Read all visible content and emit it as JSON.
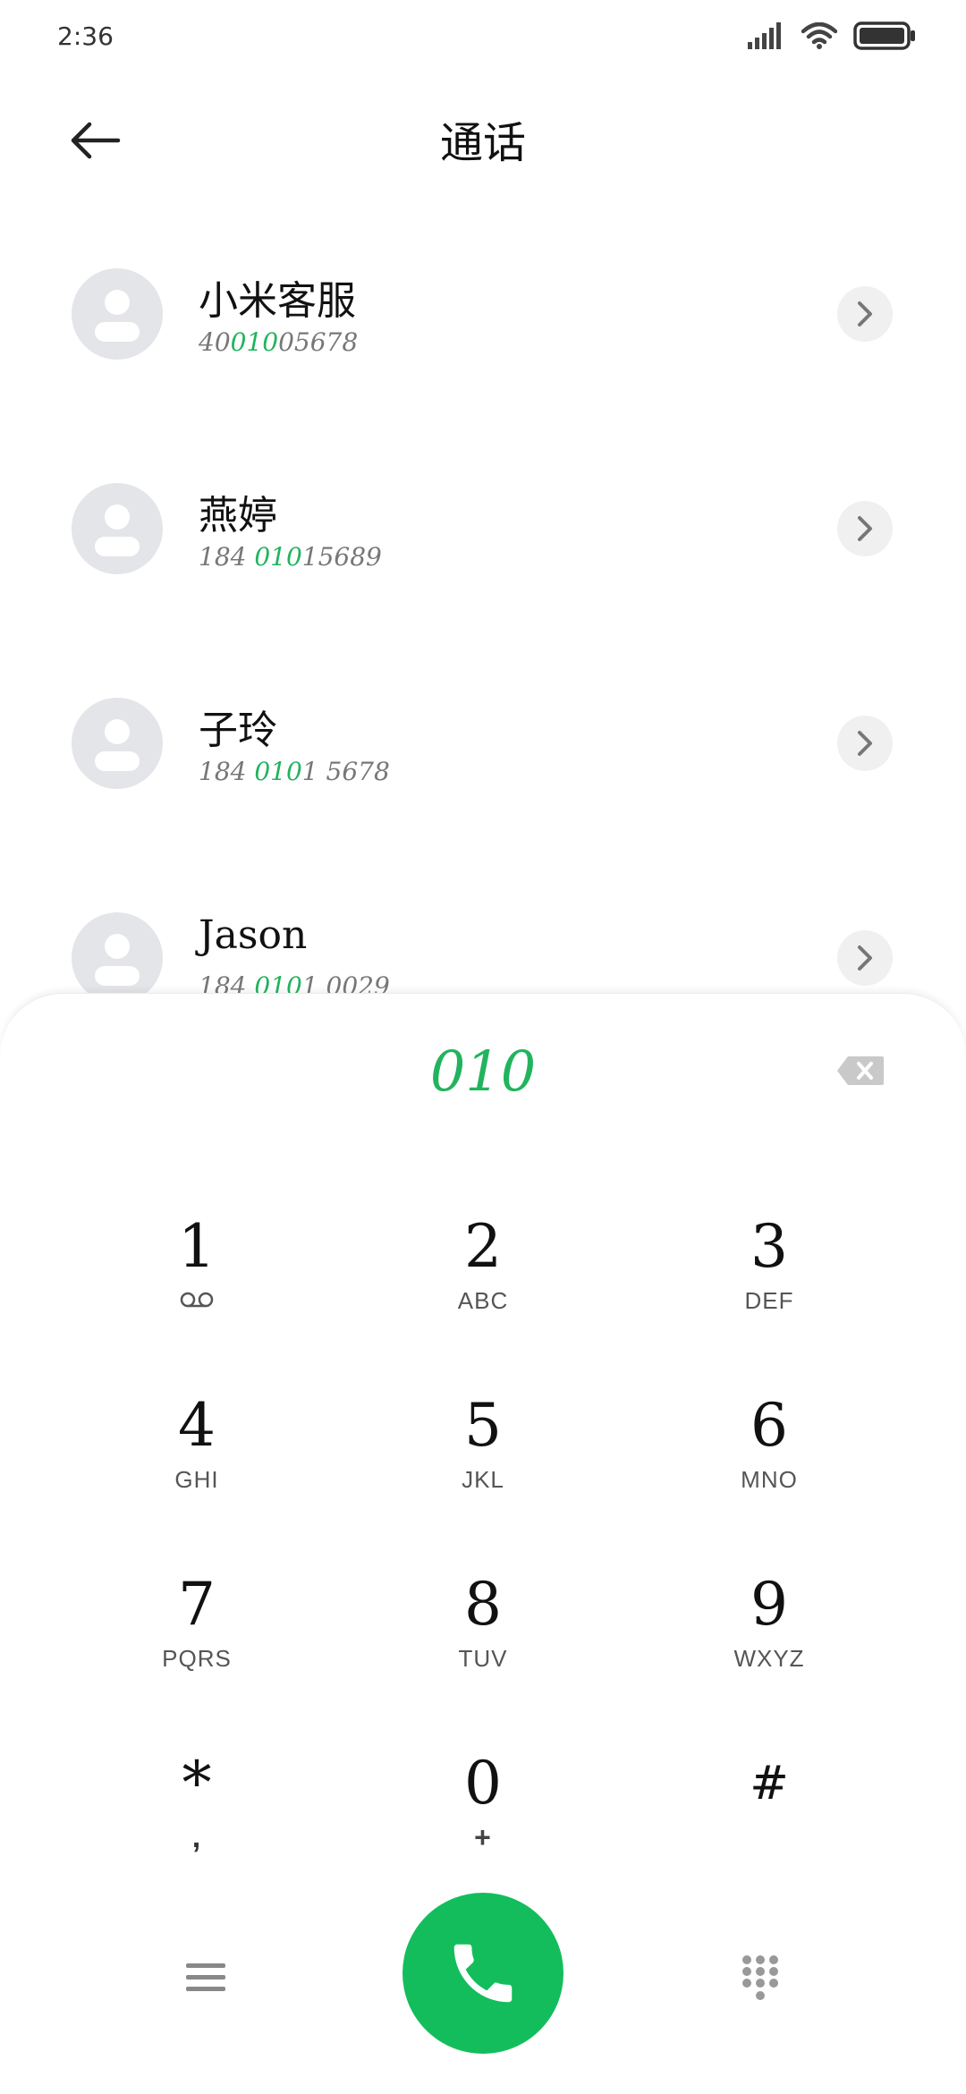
{
  "status_bar": {
    "time": "2:36",
    "icons": [
      "signal-icon",
      "wifi-icon",
      "battery-icon"
    ]
  },
  "header": {
    "back_icon": "back-arrow-icon",
    "title": "通话"
  },
  "results": [
    {
      "name": "小米客服",
      "number_parts": [
        "40",
        "010",
        "05678"
      ]
    },
    {
      "name": "燕婷",
      "number_parts": [
        "184 ",
        "010",
        "15689"
      ]
    },
    {
      "name": "子玲",
      "number_parts": [
        "184 ",
        "010",
        "1 5678"
      ]
    },
    {
      "name": "Jason",
      "number_parts": [
        "184 ",
        "010",
        "1 0029"
      ]
    }
  ],
  "dialpad": {
    "typed_number": "010",
    "keys": [
      {
        "digit": "1",
        "letters": ""
      },
      {
        "digit": "2",
        "letters": "ABC"
      },
      {
        "digit": "3",
        "letters": "DEF"
      },
      {
        "digit": "4",
        "letters": "GHI"
      },
      {
        "digit": "5",
        "letters": "JKL"
      },
      {
        "digit": "6",
        "letters": "MNO"
      },
      {
        "digit": "7",
        "letters": "PQRS"
      },
      {
        "digit": "8",
        "letters": "TUV"
      },
      {
        "digit": "9",
        "letters": "WXYZ"
      },
      {
        "digit": "*",
        "letters": ","
      },
      {
        "digit": "0",
        "letters": "+"
      },
      {
        "digit": "#",
        "letters": ""
      }
    ]
  },
  "colors": {
    "accent": "#22b35e",
    "call_button": "#14bd5c",
    "avatar_bg": "#e3e5e8"
  }
}
